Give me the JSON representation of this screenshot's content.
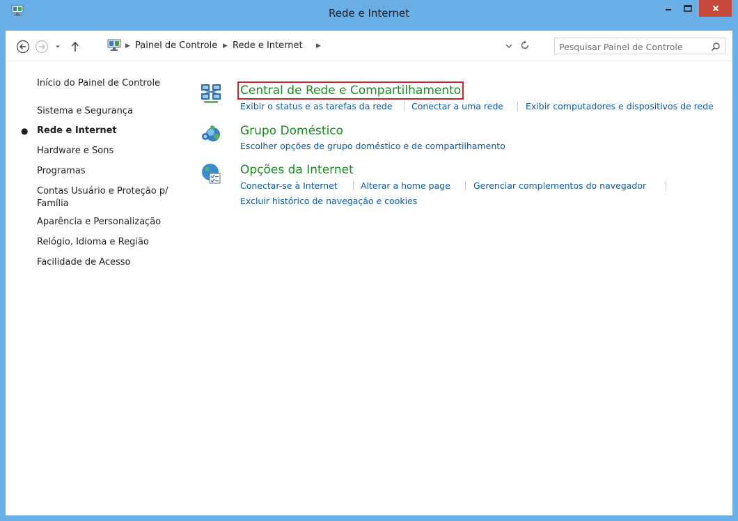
{
  "window": {
    "title": "Rede e Internet"
  },
  "breadcrumb": {
    "items": [
      "Painel de Controle",
      "Rede e Internet"
    ]
  },
  "search": {
    "placeholder": "Pesquisar Painel de Controle"
  },
  "sidebar": {
    "items": [
      {
        "label": "Início do Painel de Controle"
      },
      {
        "label": "Sistema e Segurança"
      },
      {
        "label": "Rede e Internet",
        "active": true
      },
      {
        "label": "Hardware e Sons"
      },
      {
        "label": "Programas"
      },
      {
        "label_line1": "Contas Usuário e Proteção p/",
        "label_line2": "Família"
      },
      {
        "label": "Aparência e Personalização"
      },
      {
        "label": "Relógio, Idioma e Região"
      },
      {
        "label": "Facilidade de Acesso"
      }
    ]
  },
  "categories": [
    {
      "title": "Central de Rede e Compartilhamento",
      "icon": "network-center-icon",
      "links": [
        "Exibir o status e as tarefas da rede",
        "Conectar a uma rede",
        "Exibir computadores e dispositivos de rede"
      ]
    },
    {
      "title": "Grupo Doméstico",
      "icon": "homegroup-icon",
      "links": [
        "Escolher opções de grupo doméstico e de compartilhamento"
      ]
    },
    {
      "title": "Opções da Internet",
      "icon": "internet-options-icon",
      "links": [
        "Conectar-se à Internet",
        "Alterar a home page",
        "Gerenciar complementos do navegador",
        "Excluir histórico de navegação e cookies"
      ]
    }
  ],
  "colors": {
    "frame": "#6aaee6",
    "category_title": "#1a8a23",
    "link": "#0c5aa6",
    "highlight_box": "#c4262d",
    "close_button": "#c7473b"
  }
}
